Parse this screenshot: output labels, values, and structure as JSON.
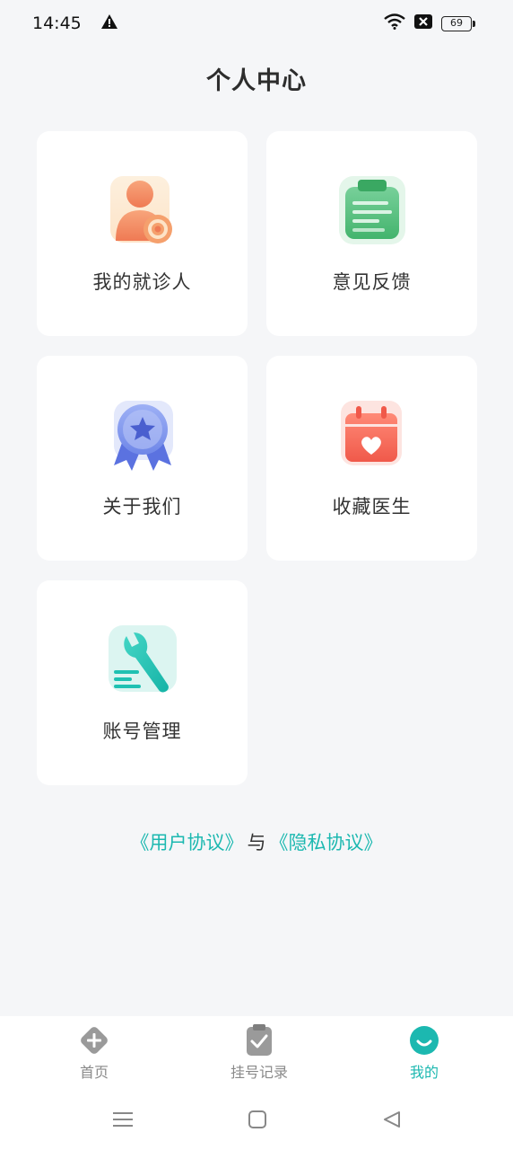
{
  "status_bar": {
    "time": "14:45",
    "battery": "69",
    "icons": [
      "alert-icon",
      "wifi-icon",
      "notification-icon",
      "battery-icon"
    ]
  },
  "header": {
    "title": "个人中心"
  },
  "menu": {
    "items": [
      {
        "label": "我的就诊人",
        "icon": "patient-settings-icon"
      },
      {
        "label": "意见反馈",
        "icon": "feedback-clipboard-icon"
      },
      {
        "label": "关于我们",
        "icon": "award-badge-icon"
      },
      {
        "label": "收藏医生",
        "icon": "calendar-heart-icon"
      },
      {
        "label": "账号管理",
        "icon": "wrench-icon"
      }
    ]
  },
  "agreements": {
    "user_agreement": "《用户协议》",
    "separator": "与",
    "privacy_agreement": "《隐私协议》"
  },
  "tabbar": {
    "tabs": [
      {
        "label": "首页",
        "icon": "home-plus-icon",
        "active": false
      },
      {
        "label": "挂号记录",
        "icon": "clipboard-check-icon",
        "active": false
      },
      {
        "label": "我的",
        "icon": "smile-face-icon",
        "active": true
      }
    ]
  },
  "colors": {
    "accent": "#1cb8b0",
    "background": "#f5f6f8",
    "card": "#ffffff"
  }
}
